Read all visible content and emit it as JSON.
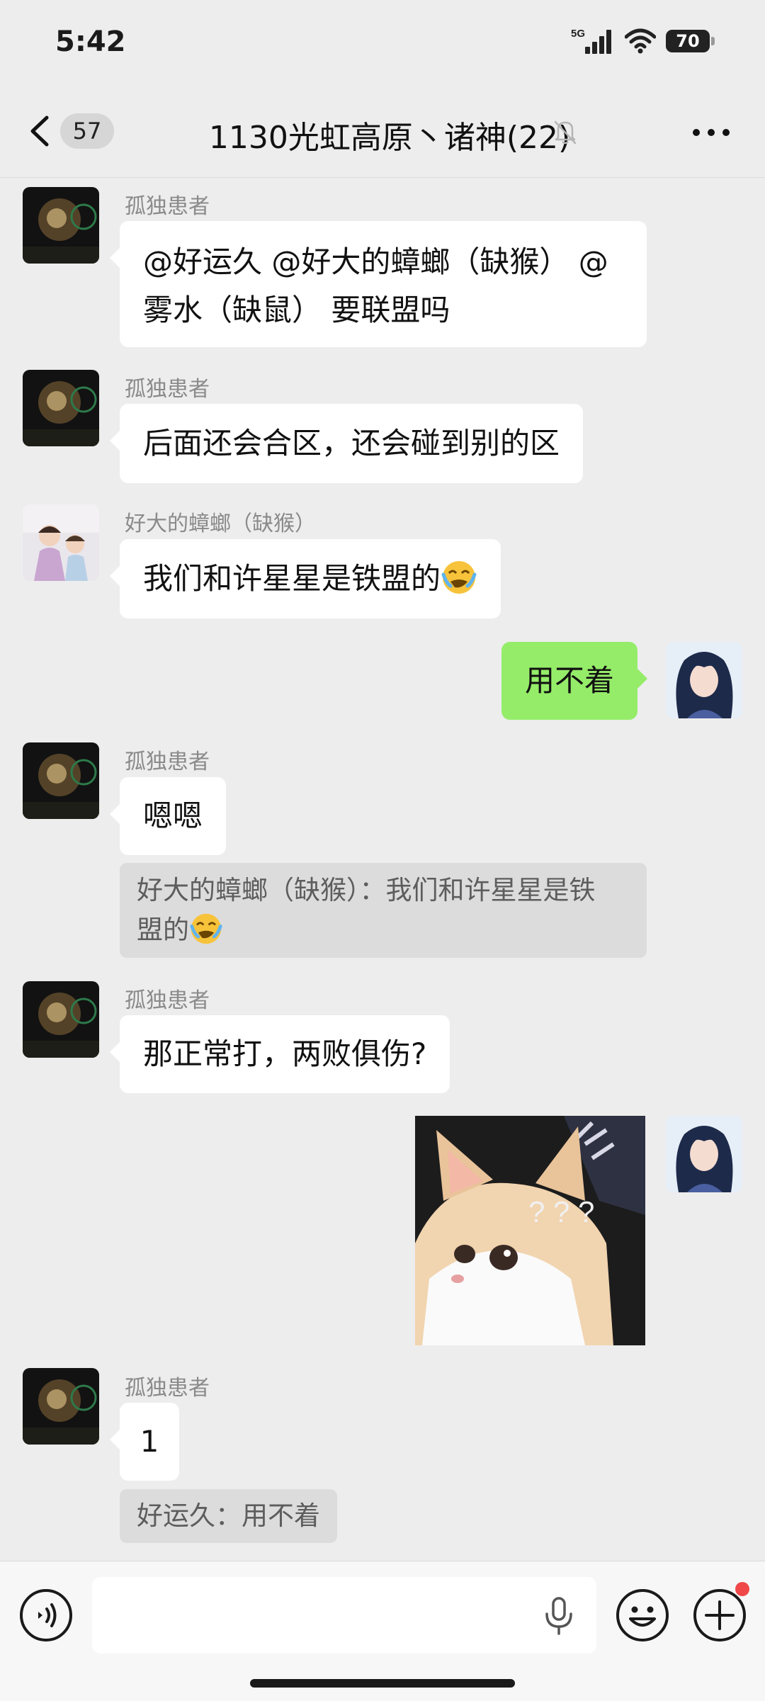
{
  "status_bar": {
    "time": "5:42",
    "network": "5G",
    "battery": "70"
  },
  "header": {
    "back_count": "57",
    "title": "1130光虹高原丶诸神(22)"
  },
  "messages": [
    {
      "sender": "孤独患者",
      "text_line1": "@好运久 @好大的蟑螂（缺猴） @",
      "text_line2": "雾水（缺鼠）  要联盟吗"
    },
    {
      "sender": "孤独患者",
      "text": "后面还会合区，还会碰到别的区"
    },
    {
      "sender": "好大的蟑螂（缺猴）",
      "text": "我们和许星星是铁盟的",
      "emoji": "face-holding-back-tears"
    },
    {
      "sender": "me",
      "text": "用不着"
    },
    {
      "sender": "孤独患者",
      "text": "嗯嗯",
      "quote_line1": "好大的蟑螂（缺猴）：我们和许星星是铁",
      "quote_line2": "盟的",
      "quote_emoji": "face-holding-back-tears"
    },
    {
      "sender": "孤独患者",
      "text": "那正常打，两败俱伤?"
    },
    {
      "sender": "me",
      "sticker": "confused-cat-sticker",
      "sticker_text": "? ? ?"
    },
    {
      "sender": "孤独患者",
      "text": "1",
      "quote": "好运久：用不着"
    }
  ],
  "input_bar": {
    "placeholder": ""
  }
}
